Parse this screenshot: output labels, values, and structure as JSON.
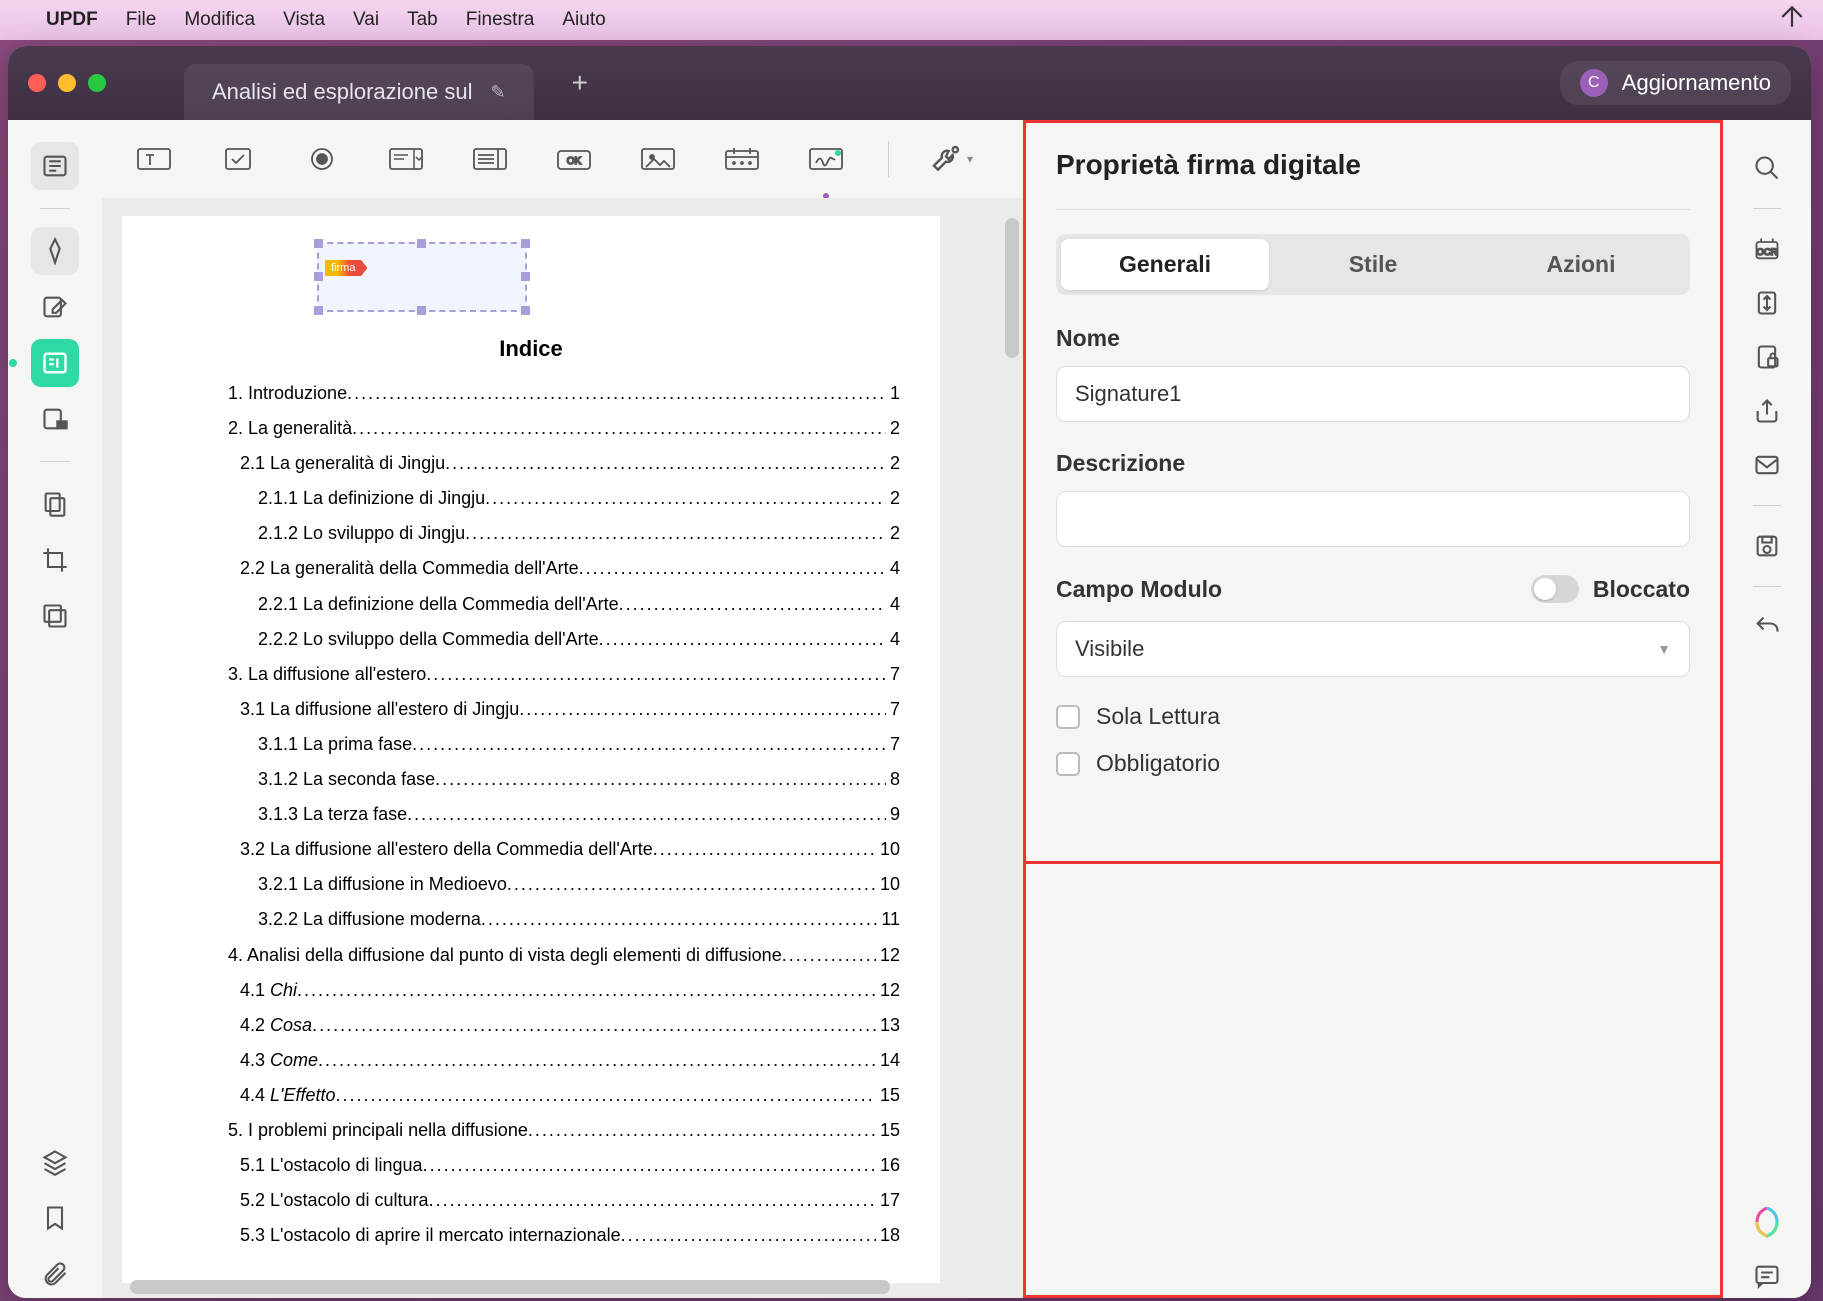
{
  "menubar": {
    "app": "UPDF",
    "items": [
      "File",
      "Modifica",
      "Vista",
      "Vai",
      "Tab",
      "Finestra",
      "Aiuto"
    ]
  },
  "tab": {
    "title": "Analisi ed esplorazione sul"
  },
  "user": {
    "initial": "C",
    "label": "Aggiornamento"
  },
  "sig_tag": "firma",
  "doc": {
    "title": "Indice",
    "toc": [
      {
        "ind": 0,
        "label": "1. Introduzione",
        "pg": "1"
      },
      {
        "ind": 0,
        "label": "2. La generalità",
        "pg": "2"
      },
      {
        "ind": 1,
        "label": "2.1 La generalità di Jingju",
        "pg": "2"
      },
      {
        "ind": 2,
        "label": "2.1.1 La definizione di Jingju",
        "pg": "2"
      },
      {
        "ind": 2,
        "label": "2.1.2 Lo sviluppo di Jingju",
        "pg": "2"
      },
      {
        "ind": 1,
        "label": "2.2 La generalità della Commedia dell'Arte",
        "pg": "4"
      },
      {
        "ind": 2,
        "label": "2.2.1 La definizione della Commedia dell'Arte",
        "pg": "4"
      },
      {
        "ind": 2,
        "label": "2.2.2 Lo sviluppo della Commedia dell'Arte",
        "pg": "4"
      },
      {
        "ind": 0,
        "label": "3. La diffusione all'estero",
        "pg": "7"
      },
      {
        "ind": 1,
        "label": "3.1 La diffusione all'estero di Jingju",
        "pg": "7"
      },
      {
        "ind": 2,
        "label": "3.1.1 La prima fase",
        "pg": "7"
      },
      {
        "ind": 2,
        "label": "3.1.2 La seconda fase",
        "pg": "8"
      },
      {
        "ind": 2,
        "label": "3.1.3 La terza fase",
        "pg": "9"
      },
      {
        "ind": 1,
        "label": "3.2 La diffusione all'estero della Commedia dell'Arte",
        "pg": "10"
      },
      {
        "ind": 2,
        "label": "3.2.1 La diffusione in Medioevo",
        "pg": "10"
      },
      {
        "ind": 2,
        "label": "3.2.2 La diffusione moderna",
        "pg": "11"
      },
      {
        "ind": 0,
        "label": "4. Analisi della diffusione dal punto di vista degli elementi di diffusione",
        "pg": "12"
      },
      {
        "ind": 1,
        "label": "4.1 ",
        "italic": "Chi",
        "pg": "12"
      },
      {
        "ind": 1,
        "label": "4.2 ",
        "italic": "Cosa",
        "pg": "13"
      },
      {
        "ind": 1,
        "label": "4.3 ",
        "italic": "Come",
        "pg": "14"
      },
      {
        "ind": 1,
        "label": "4.4 ",
        "italic": "L'Effetto",
        "pg": "15"
      },
      {
        "ind": 0,
        "label": "5. I problemi principali nella diffusione",
        "pg": "15"
      },
      {
        "ind": 1,
        "label": "5.1 L'ostacolo di lingua",
        "pg": "16"
      },
      {
        "ind": 1,
        "label": "5.2 L'ostacolo di cultura",
        "pg": "17"
      },
      {
        "ind": 1,
        "label": "5.3 L'ostacolo di aprire il mercato internazionale",
        "pg": "18"
      }
    ]
  },
  "panel": {
    "title": "Proprietà firma digitale",
    "tabs": {
      "generali": "Generali",
      "stile": "Stile",
      "azioni": "Azioni"
    },
    "nome_label": "Nome",
    "nome_value": "Signature1",
    "descrizione_label": "Descrizione",
    "descrizione_value": "",
    "campo_modulo_label": "Campo Modulo",
    "bloccato_label": "Bloccato",
    "visibility_value": "Visibile",
    "sola_lettura": "Sola Lettura",
    "obbligatorio": "Obbligatorio"
  }
}
